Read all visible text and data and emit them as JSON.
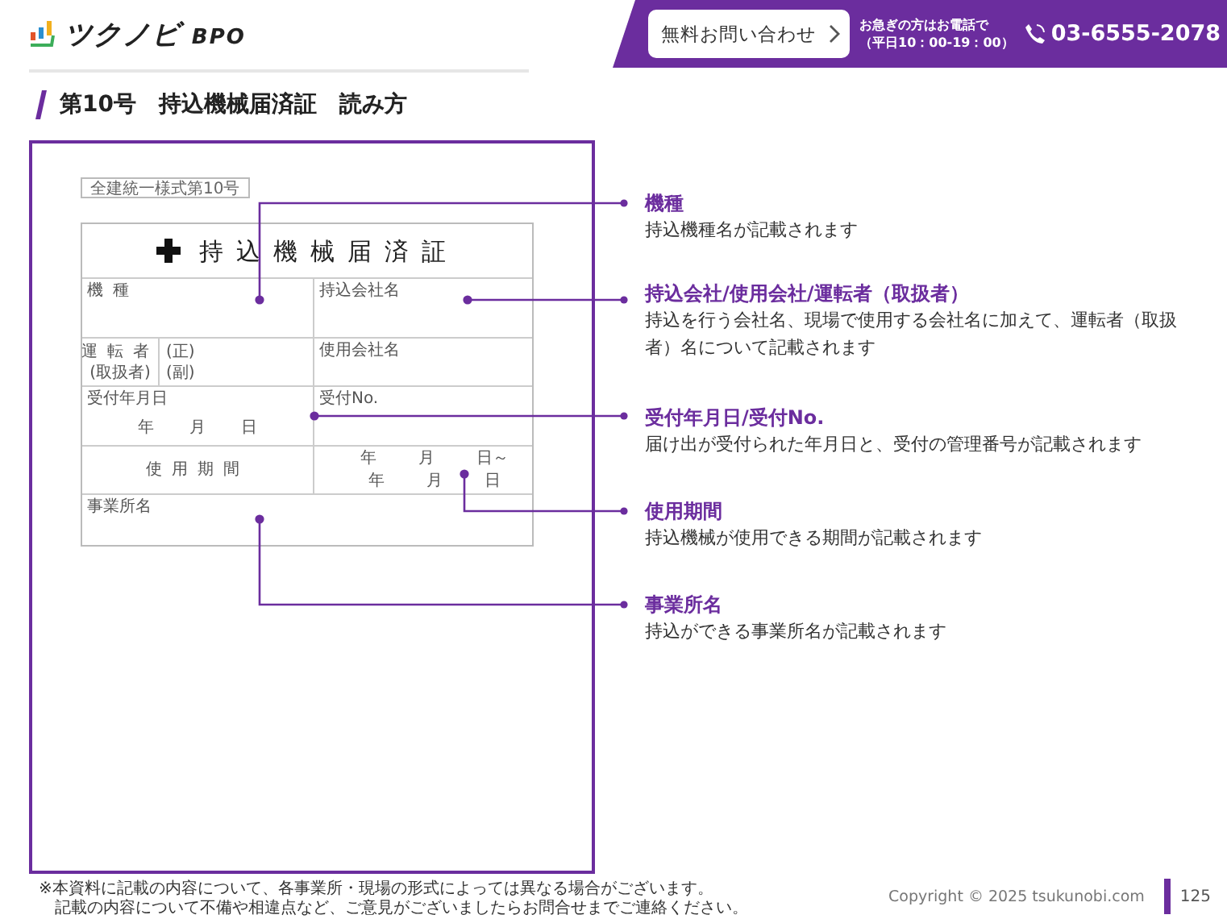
{
  "header": {
    "logo": {
      "name": "ツクノビ",
      "suffix": "BPO"
    },
    "contact_button": "無料お問い合わせ",
    "contact_note": [
      "お急ぎの方はお電話で",
      "（平日10：00-19：00）"
    ],
    "phone": "03-6555-2078"
  },
  "title": "第10号　持込機械届済証　読み方",
  "form": {
    "form_number": "全建統一様式第10号",
    "title": "持込機械届済証",
    "model": "機種",
    "bringing_company": "持込会社名",
    "operator": "運転者",
    "operator_sub": "(取扱者)",
    "primary": "(正)",
    "secondary": "(副)",
    "user_company": "使用会社名",
    "received_date": "受付年月日",
    "date_parts": [
      "年",
      "月",
      "日"
    ],
    "received_no": "受付No.",
    "period": "使用期間",
    "period_from": [
      "年",
      "月",
      "日～"
    ],
    "period_to": [
      "年",
      "月",
      "日"
    ],
    "office": "事業所名"
  },
  "callouts": [
    {
      "title": "機種",
      "description": "持込機種名が記載されます"
    },
    {
      "title": "持込会社/使用会社/運転者（取扱者）",
      "description": "持込を行う会社名、現場で使用する会社名に加えて、運転者（取扱者）名について記載されます"
    },
    {
      "title": "受付年月日/受付No.",
      "description": "届け出が受付られた年月日と、受付の管理番号が記載されます"
    },
    {
      "title": "使用期間",
      "description": "持込機械が使用できる期間が記載されます"
    },
    {
      "title": "事業所名",
      "description": "持込ができる事業所名が記載されます"
    }
  ],
  "footer": {
    "notes": [
      "※本資料に記載の内容について、各事業所・現場の形式によっては異なる場合がございます。",
      "記載の内容について不備や相違点など、ご意見がございましたらお問合せまでご連絡ください。"
    ],
    "copyright": "Copyright © 2025 tsukunobi.com",
    "page": "125"
  }
}
